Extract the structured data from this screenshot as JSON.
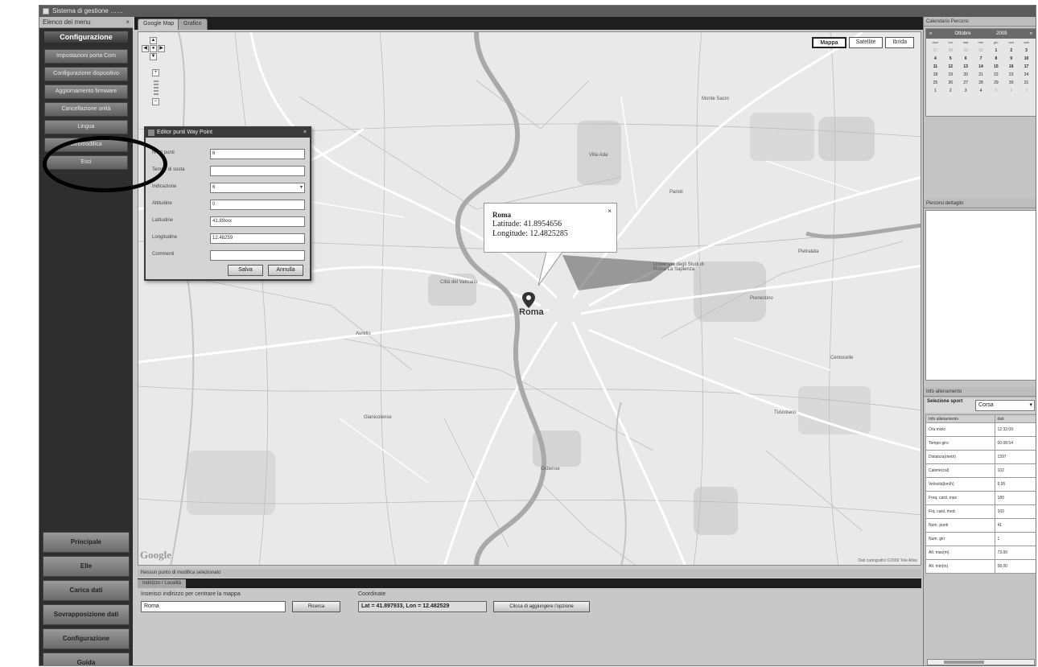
{
  "window": {
    "title": "Sistema di gestione ……"
  },
  "sidebar": {
    "panel_title": "Elenco dei menu",
    "close": "×",
    "section_title": "Configurazione",
    "items": [
      {
        "label": "Impostazioni porta Com"
      },
      {
        "label": "Configurazione dispositivo"
      },
      {
        "label": "Aggiornamento firmware"
      },
      {
        "label": "Cancellazione unità"
      },
      {
        "label": "Lingua"
      },
      {
        "label": "Geomodifica"
      },
      {
        "label": "Esci"
      }
    ],
    "main_buttons": [
      {
        "label": "Principale"
      },
      {
        "label": "Elle"
      },
      {
        "label": "Carica dati"
      },
      {
        "label": "Sovrapposizione dati"
      },
      {
        "label": "Configurazione"
      },
      {
        "label": "Guida"
      }
    ]
  },
  "map_tabs": [
    {
      "label": "Google Map"
    },
    {
      "label": "Grafico"
    }
  ],
  "map": {
    "types": [
      {
        "label": "Mappa"
      },
      {
        "label": "Satellite"
      },
      {
        "label": "Ibrida"
      }
    ],
    "active_type": "Mappa",
    "logo": "Google",
    "copyright": "Dati cartografici ©2009 Tele Atlas",
    "labels": [
      {
        "text": "Città del Vaticano"
      },
      {
        "text": "Università degli Studi di Roma La Sapienza"
      },
      {
        "text": "Monte Sacro"
      },
      {
        "text": "Aurelio"
      },
      {
        "text": "Villa Ada"
      },
      {
        "text": "Pietralata"
      },
      {
        "text": "Prenestino"
      },
      {
        "text": "Gianicolense"
      },
      {
        "text": "Tuscolano"
      },
      {
        "text": "Ostiense"
      },
      {
        "text": "Centocelle"
      },
      {
        "text": "Parioli"
      }
    ],
    "city": "Roma"
  },
  "dialog": {
    "title": "Editor punti Way Point",
    "close": "×",
    "rows": [
      {
        "label": "N° di punti",
        "value": "6"
      },
      {
        "label": "Tempo di sosta",
        "value": ""
      },
      {
        "label": "Indicazione",
        "value": "6"
      },
      {
        "label": "Altitudine",
        "value": "0"
      },
      {
        "label": "Latitudine",
        "value": "41.89xxx"
      },
      {
        "label": "Longitudine",
        "value": "12.48259"
      },
      {
        "label": "Commenti",
        "value": ""
      }
    ],
    "save": "Salva",
    "cancel": "Annulla"
  },
  "popup": {
    "name": "Roma",
    "lat_line": "Latitude: 41.8954656",
    "lng_line": "Longitude: 12.4825285",
    "close": "×"
  },
  "status": {
    "text": "Nessun punto di modifica selezionato"
  },
  "bottom": {
    "tab": "Indirizzo / Località",
    "address_label": "Inserisci indirizzo per centrare la mappa",
    "address_value": "Roma",
    "search_button": "Ricerca",
    "coords_label": "Coordinate",
    "coords_value": "Lat = 41.897933, Lon = 12.482529",
    "update_button": "Clicca di aggiungere l'opzione"
  },
  "calendar": {
    "panel_title": "Calendario Percorsi",
    "month": "Ottobre",
    "year": "2009",
    "prev": "«",
    "next": "»",
    "days_of_week": [
      "dom",
      "lun",
      "mar",
      "mer",
      "gio",
      "ven",
      "sab"
    ],
    "cells": [
      "27",
      "28",
      "29",
      "30",
      "1",
      "2",
      "3",
      "4",
      "5",
      "6",
      "7",
      "8",
      "9",
      "10",
      "11",
      "12",
      "13",
      "14",
      "15",
      "16",
      "17",
      "18",
      "19",
      "20",
      "21",
      "22",
      "23",
      "24",
      "25",
      "26",
      "27",
      "28",
      "29",
      "30",
      "31",
      "1",
      "2",
      "3",
      "4",
      "5",
      "6",
      "7"
    ]
  },
  "records": {
    "panel_title": "Percorsi dettaglio"
  },
  "info": {
    "panel_title": "Info allenamento",
    "sport_label": "Selezione sport",
    "sport_value": "Corsa",
    "table_head": [
      "Info allenamento",
      "dati"
    ],
    "rows": [
      {
        "label": "Ora inizio",
        "value": "12:32:09"
      },
      {
        "label": "Tempo giro",
        "value": "00:08:54"
      },
      {
        "label": "Distanza(metri)",
        "value": "1397"
      },
      {
        "label": "Calorie(cal)",
        "value": "102"
      },
      {
        "label": "Velocità(km/h)",
        "value": "9,95"
      },
      {
        "label": "Freq. card. max",
        "value": "180"
      },
      {
        "label": "Frq. card. med.",
        "value": "160"
      },
      {
        "label": "Num. punti",
        "value": "41"
      },
      {
        "label": "Num. giri",
        "value": "1"
      },
      {
        "label": "Alt. max(m)",
        "value": "73,00"
      },
      {
        "label": "Alt. min(m)",
        "value": "58,00"
      }
    ]
  }
}
